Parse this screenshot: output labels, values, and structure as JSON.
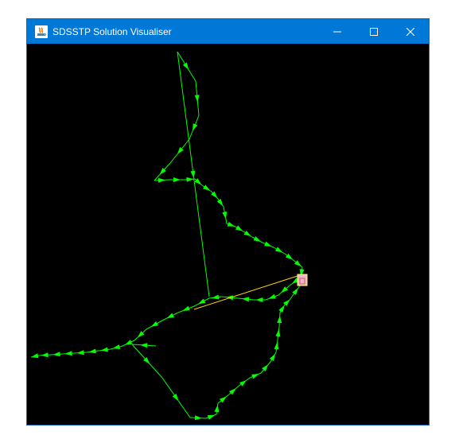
{
  "window": {
    "title": "SDSSTP Solution Visualiser",
    "controls": {
      "minimize_icon": "minimize-icon",
      "maximize_icon": "maximize-icon",
      "close_icon": "close-icon"
    }
  },
  "colors": {
    "titlebar": "#0078d7",
    "canvas_background": "#000000",
    "route": "#00ff00",
    "depot_link": "#ffd400",
    "depot_fill": "#f4b6c6",
    "depot_border": "#ffff66"
  }
}
